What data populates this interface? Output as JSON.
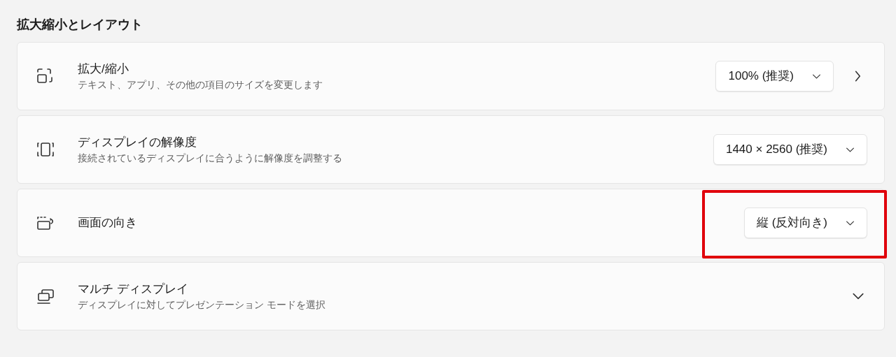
{
  "section_title": "拡大縮小とレイアウト",
  "rows": [
    {
      "kind": "link",
      "title": "拡大/縮小",
      "description": "テキスト、アプリ、その他の項目のサイズを変更します",
      "dropdown": "100% (推奨)",
      "highlighted": false
    },
    {
      "kind": "select",
      "title": "ディスプレイの解像度",
      "description": "接続されているディスプレイに合うように解像度を調整する",
      "dropdown": "1440 × 2560 (推奨)",
      "highlighted": false
    },
    {
      "kind": "select",
      "title": "画面の向き",
      "dropdown": "縦 (反対向き)",
      "highlighted": true
    },
    {
      "kind": "expander",
      "title": "マルチ ディスプレイ",
      "description": "ディスプレイに対してプレゼンテーション モードを選択",
      "highlighted": false
    }
  ]
}
